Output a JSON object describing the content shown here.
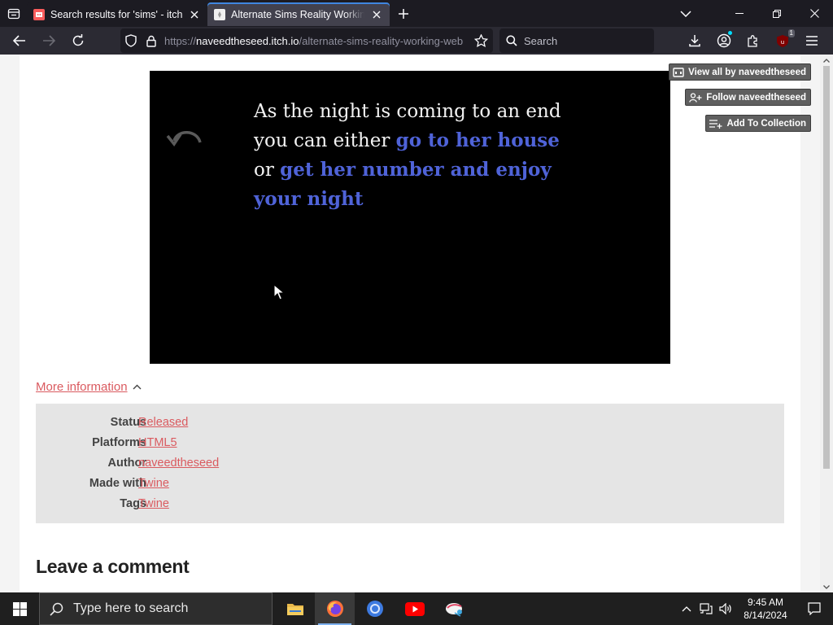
{
  "browser": {
    "tabs": [
      {
        "title": "Search results for 'sims' - itch.io",
        "active": false
      },
      {
        "title": "Alternate Sims Reality Working Web",
        "active": true
      }
    ],
    "url_prefix": "https://",
    "url_host": "naveedtheseed.itch.io",
    "url_path": "/alternate-sims-reality-working-web",
    "search_placeholder": "Search",
    "extension_badge": "1"
  },
  "side_buttons": {
    "view_all": "View all by naveedtheseed",
    "follow": "Follow naveedtheseed",
    "add_collection": "Add To Collection"
  },
  "game": {
    "text_1": "As the night is coming to an end you can either ",
    "link_1": "go to her house",
    "text_2": " or ",
    "link_2": "get her number and enjoy your night"
  },
  "info": {
    "toggle_label": "More information",
    "rows": [
      {
        "key": "Status",
        "value": "Released"
      },
      {
        "key": "Platforms",
        "value": "HTML5"
      },
      {
        "key": "Author",
        "value": "naveedtheseed"
      },
      {
        "key": "Made with",
        "value": "Twine"
      },
      {
        "key": "Tags",
        "value": "Twine"
      }
    ]
  },
  "comments": {
    "heading": "Leave a comment"
  },
  "taskbar": {
    "search_placeholder": "Type here to search",
    "time": "9:45 AM",
    "date": "8/14/2024"
  },
  "colors": {
    "accent_link": "#da5a5f",
    "story_link": "#4f63d8",
    "tab_indicator": "#3f86e0"
  }
}
